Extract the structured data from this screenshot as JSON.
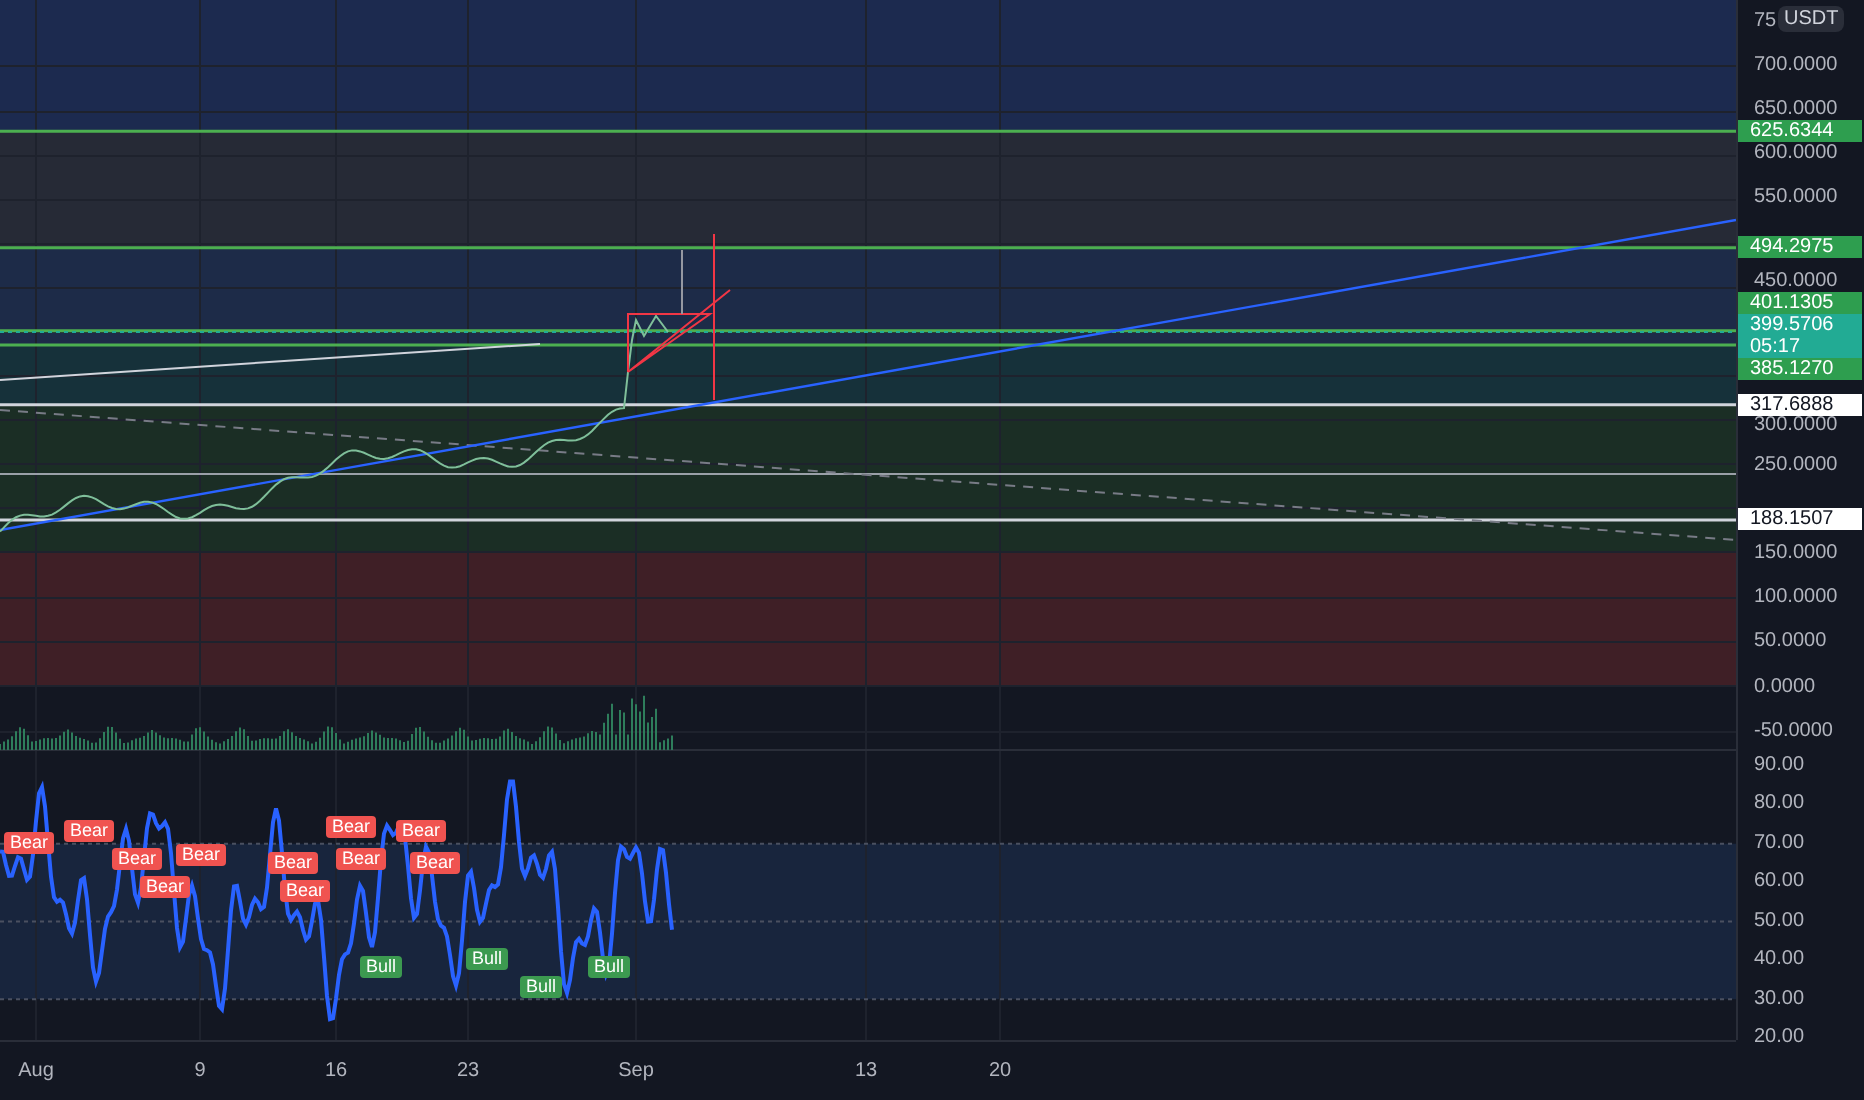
{
  "price_axis": {
    "unit": "USDT",
    "cut_tick": "75",
    "ticks": [
      "700.0000",
      "650.0000",
      "600.0000",
      "550.0000",
      "450.0000",
      "300.0000",
      "250.0000",
      "150.0000",
      "100.0000",
      "50.0000",
      "0.0000",
      "-50.0000"
    ]
  },
  "price_tags": [
    {
      "value": "625.6344",
      "color": "#2e9e4f"
    },
    {
      "value": "494.2975",
      "color": "#2e9e4f"
    },
    {
      "value": "401.1305",
      "color": "#2e9e4f"
    },
    {
      "value": "399.5706",
      "countdown": "05:17",
      "color": "#22ab94"
    },
    {
      "value": "385.1270",
      "color": "#2e9e4f"
    },
    {
      "value": "317.6888",
      "color": "#ffffff"
    },
    {
      "value": "188.1507",
      "color": "#ffffff"
    }
  ],
  "rsi_axis": {
    "ticks": [
      "90.00",
      "80.00",
      "70.00",
      "60.00",
      "50.00",
      "40.00",
      "30.00",
      "20.00"
    ]
  },
  "signals": [
    {
      "kind": "bear",
      "label": "Bear"
    },
    {
      "kind": "bear",
      "label": "Bear"
    },
    {
      "kind": "bear",
      "label": "Bear"
    },
    {
      "kind": "bear",
      "label": "Bear"
    },
    {
      "kind": "bear",
      "label": "Bear"
    },
    {
      "kind": "bear",
      "label": "Bear"
    },
    {
      "kind": "bear",
      "label": "Bear"
    },
    {
      "kind": "bear",
      "label": "Bear"
    },
    {
      "kind": "bear",
      "label": "Bear"
    },
    {
      "kind": "bear",
      "label": "Bear"
    },
    {
      "kind": "bear",
      "label": "Bear"
    },
    {
      "kind": "bull",
      "label": "Bull"
    },
    {
      "kind": "bull",
      "label": "Bull"
    },
    {
      "kind": "bull",
      "label": "Bull"
    },
    {
      "kind": "bull",
      "label": "Bull"
    }
  ],
  "time_axis": {
    "ticks": [
      "Aug",
      "9",
      "16",
      "23",
      "Sep",
      "13",
      "20"
    ]
  }
}
